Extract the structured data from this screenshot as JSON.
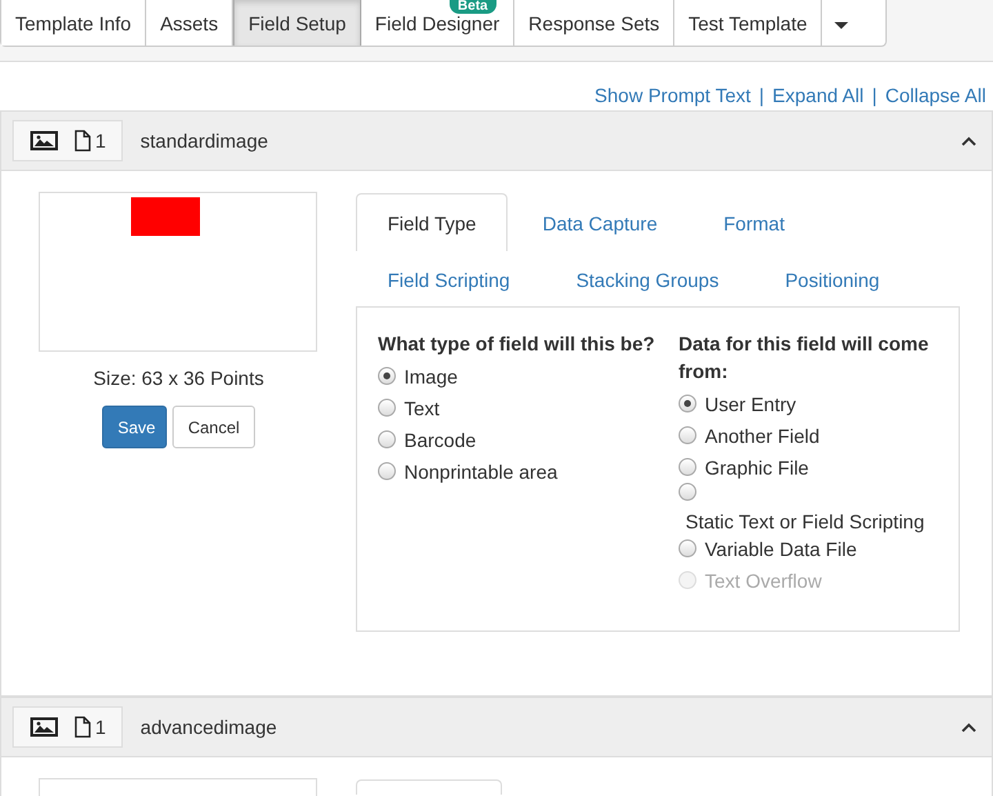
{
  "nav_tabs": [
    {
      "label": "Template Info",
      "selected": false
    },
    {
      "label": "Assets",
      "selected": false
    },
    {
      "label": "Field Setup",
      "selected": true
    },
    {
      "label": "Field Designer",
      "selected": false,
      "badge": "Beta"
    },
    {
      "label": "Response Sets",
      "selected": false
    },
    {
      "label": "Test Template",
      "selected": false
    }
  ],
  "links": [
    "Show Prompt Text",
    "Expand All",
    "Collapse All"
  ],
  "link_separators": [
    "|",
    "|"
  ],
  "fields": [
    {
      "page_count": "1",
      "name": "standardimage",
      "expanded": true,
      "preview": {
        "size": "Size: 63 x 36 Points"
      },
      "buttons": [
        {
          "label": "Save",
          "kind": "primary"
        },
        {
          "label": "Cancel",
          "kind": "default"
        }
      ],
      "tab_rows": [
        [
          {
            "label": "Field Type",
            "selected": true
          },
          {
            "label": "Data Capture",
            "selected": false
          },
          {
            "label": "Format",
            "selected": false
          }
        ],
        [
          {
            "label": "Field Scripting",
            "selected": false
          },
          {
            "label": "Stacking Groups",
            "selected": false
          },
          {
            "label": "Positioning",
            "selected": false
          }
        ]
      ],
      "groups": [
        {
          "heading": "What type of field will this be?",
          "options": [
            {
              "label": "Image",
              "selected": true,
              "disabled": false,
              "label_below": false
            },
            {
              "label": "Text",
              "selected": false,
              "disabled": false,
              "label_below": false
            },
            {
              "label": "Barcode",
              "selected": false,
              "disabled": false,
              "label_below": false
            },
            {
              "label": "Nonprintable area",
              "selected": false,
              "disabled": false,
              "label_below": false
            }
          ]
        },
        {
          "heading": "Data for this field will come from:",
          "options": [
            {
              "label": "User Entry",
              "selected": true,
              "disabled": false,
              "label_below": false
            },
            {
              "label": "Another Field",
              "selected": false,
              "disabled": false,
              "label_below": false
            },
            {
              "label": "Graphic File",
              "selected": false,
              "disabled": false,
              "label_below": false
            },
            {
              "label": "Static Text or Field Scripting",
              "selected": false,
              "disabled": false,
              "label_below": true
            },
            {
              "label": "Variable Data File",
              "selected": false,
              "disabled": false,
              "label_below": false
            },
            {
              "label": "Text Overflow",
              "selected": false,
              "disabled": true,
              "label_below": false
            }
          ]
        }
      ]
    },
    {
      "page_count": "1",
      "name": "advancedimage",
      "expanded": true
    }
  ]
}
